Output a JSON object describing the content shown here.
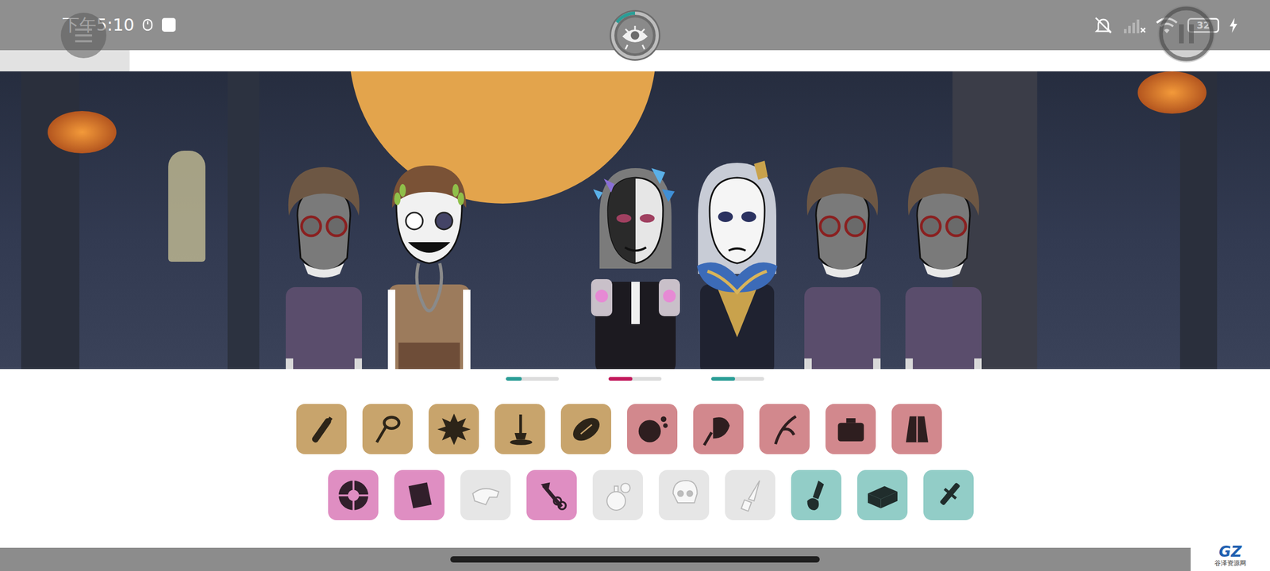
{
  "status_bar": {
    "time": "下午5:10",
    "battery": "32"
  },
  "record_ring": {
    "level": 0.15
  },
  "characters": [
    {
      "kind": "idle"
    },
    {
      "kind": "laurel"
    },
    {
      "kind": "butterfly"
    },
    {
      "kind": "priest"
    },
    {
      "kind": "idle"
    },
    {
      "kind": "idle"
    }
  ],
  "mix_meters": [
    {
      "level": 0.3,
      "color": "#2a9d96"
    },
    {
      "level": 0.45,
      "color": "#c2185b"
    },
    {
      "level": 0.45,
      "color": "#2a9d96"
    }
  ],
  "sound_rows": [
    [
      {
        "color": "#c8a46c",
        "disabled": false
      },
      {
        "color": "#c8a46c",
        "disabled": false
      },
      {
        "color": "#c8a46c",
        "disabled": false
      },
      {
        "color": "#c8a46c",
        "disabled": false
      },
      {
        "color": "#c8a46c",
        "disabled": false
      },
      {
        "color": "#d2888d",
        "disabled": false
      },
      {
        "color": "#d2888d",
        "disabled": false
      },
      {
        "color": "#d2888d",
        "disabled": false
      },
      {
        "color": "#d2888d",
        "disabled": false
      },
      {
        "color": "#d2888d",
        "disabled": false
      }
    ],
    [
      {
        "color": "#df8ec2",
        "disabled": false
      },
      {
        "color": "#df8ec2",
        "disabled": false
      },
      {
        "color": "#e6e6e6",
        "disabled": true
      },
      {
        "color": "#df8ec2",
        "disabled": false
      },
      {
        "color": "#e6e6e6",
        "disabled": true
      },
      {
        "color": "#e6e6e6",
        "disabled": true
      },
      {
        "color": "#e6e6e6",
        "disabled": true
      },
      {
        "color": "#92cdc7",
        "disabled": false
      },
      {
        "color": "#92cdc7",
        "disabled": false
      },
      {
        "color": "#92cdc7",
        "disabled": false
      }
    ]
  ],
  "watermark": {
    "logo": "GZ",
    "text": "谷泽资源网"
  }
}
